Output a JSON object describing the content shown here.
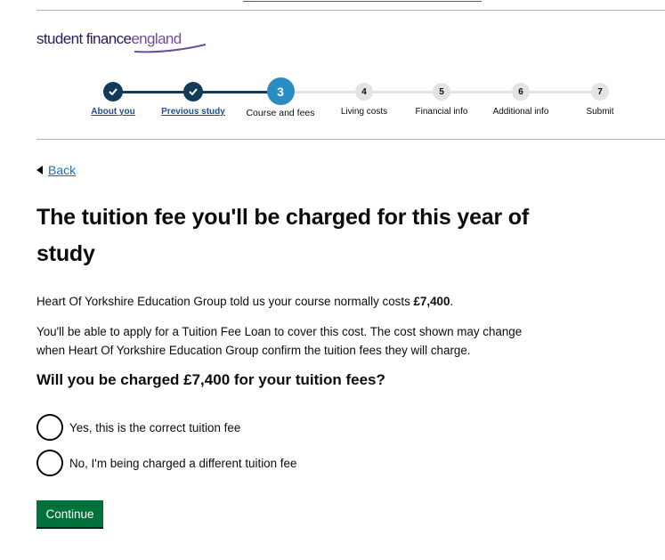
{
  "brand": {
    "w1": "student",
    "w2": "finance",
    "w3": "england"
  },
  "progress": {
    "steps": [
      {
        "num": "1",
        "label": "About you",
        "state": "done"
      },
      {
        "num": "2",
        "label": "Previous study",
        "state": "done"
      },
      {
        "num": "3",
        "label": "Course and fees",
        "state": "current"
      },
      {
        "num": "4",
        "label": "Living costs",
        "state": "todo"
      },
      {
        "num": "5",
        "label": "Financial info",
        "state": "todo"
      },
      {
        "num": "6",
        "label": "Additional info",
        "state": "todo"
      },
      {
        "num": "7",
        "label": "Submit",
        "state": "todo"
      }
    ]
  },
  "back_label": "Back",
  "heading": "The tuition fee you'll be charged for this year of study",
  "intro": {
    "prefix": "Heart Of Yorkshire Education Group told us your course normally costs ",
    "amount": "£7,400",
    "suffix": "."
  },
  "info": "You'll be able to apply for a Tuition Fee Loan to cover this cost. The cost shown may change when Heart Of Yorkshire Education Group confirm the tuition fees they will charge.",
  "question": "Will you be charged £7,400 for your tuition fees?",
  "options": [
    {
      "label": "Yes, this is the correct tuition fee",
      "selected": false
    },
    {
      "label": "No, I'm being charged a different tuition fee",
      "selected": false
    }
  ],
  "continue_label": "Continue",
  "colors": {
    "accent": "#2b8cc4",
    "done": "#123b5a",
    "link": "#1d70b8",
    "button": "#00703c"
  }
}
